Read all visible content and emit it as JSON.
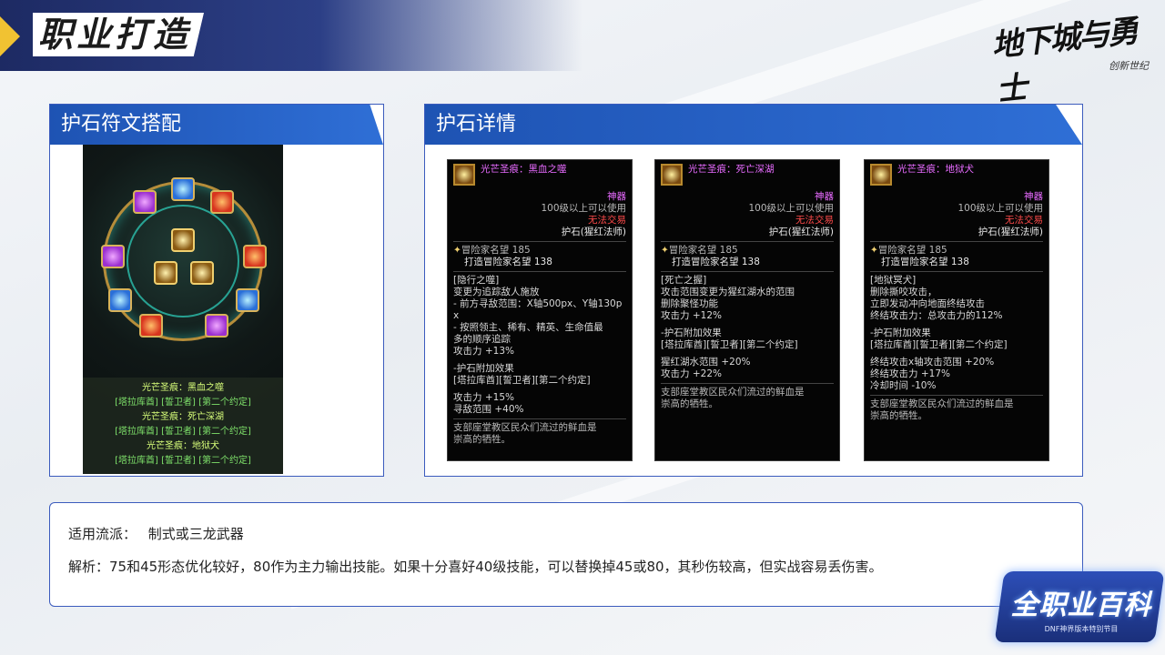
{
  "header": {
    "title": "职业打造"
  },
  "logo": {
    "text": "地下城与勇士",
    "sub": "创新世纪"
  },
  "left_panel": {
    "title": "护石符文搭配",
    "wheel_lines": [
      {
        "name": "光芒圣痕：黑血之噬",
        "sub": "[塔拉库酋] [誓卫者] [第二个约定]"
      },
      {
        "name": "光芒圣痕：死亡深湖",
        "sub": "[塔拉库酋] [誓卫者] [第二个约定]"
      },
      {
        "name": "光芒圣痕：地狱犬",
        "sub": "[塔拉库酋] [誓卫者] [第二个约定]"
      }
    ]
  },
  "right_panel": {
    "title": "护石详情",
    "cards": [
      {
        "title": "光芒圣痕：黑血之噬",
        "rarity": "神器",
        "level_req": "100级以上可以使用",
        "trade": "无法交易",
        "class": "护石(猩红法师)",
        "fame": "冒险家名望 185",
        "forge_fame": "打造冒险家名望 138",
        "skill_name": "[隐行之噬]",
        "lines": [
          "变更为追踪敌人施放",
          "- 前方寻敌范围：X轴500px、Y轴130p",
          "x",
          "- 按照领主、稀有、精英、生命值最",
          "多的顺序追踪",
          "攻击力 +13%"
        ],
        "extra_title": "-护石附加效果",
        "extra_runes": "[塔拉库酋][誓卫者][第二个约定]",
        "extra_lines": [
          "攻击力 +15%",
          "寻敌范围 +40%"
        ],
        "flavor": [
          "支部座堂教区民众们流过的鲜血是",
          "崇高的牺牲。"
        ]
      },
      {
        "title": "光芒圣痕：死亡深湖",
        "rarity": "神器",
        "level_req": "100级以上可以使用",
        "trade": "无法交易",
        "class": "护石(猩红法师)",
        "fame": "冒险家名望 185",
        "forge_fame": "打造冒险家名望 138",
        "skill_name": "[死亡之握]",
        "lines": [
          "攻击范围变更为猩红湖水的范围",
          "删除聚怪功能",
          "攻击力 +12%"
        ],
        "extra_title": "-护石附加效果",
        "extra_runes": "[塔拉库酋][誓卫者][第二个约定]",
        "extra_lines": [
          "猩红湖水范围 +20%",
          "攻击力 +22%"
        ],
        "flavor": [
          "支部座堂教区民众们流过的鲜血是",
          "崇高的牺牲。"
        ]
      },
      {
        "title": "光芒圣痕：地狱犬",
        "rarity": "神器",
        "level_req": "100级以上可以使用",
        "trade": "无法交易",
        "class": "护石(猩红法师)",
        "fame": "冒险家名望 185",
        "forge_fame": "打造冒险家名望 138",
        "skill_name": "[地狱冥犬]",
        "lines": [
          "删除撕咬攻击，",
          "立即发动冲向地面终结攻击",
          "终结攻击力：总攻击力的112%"
        ],
        "extra_title": "-护石附加效果",
        "extra_runes": "[塔拉库酋][誓卫者][第二个约定]",
        "extra_lines": [
          "终结攻击x轴攻击范围 +20%",
          "终结攻击力 +17%",
          "冷却时间 -10%"
        ],
        "flavor": [
          "支部座堂教区民众们流过的鲜血是",
          "崇高的牺牲。"
        ]
      }
    ]
  },
  "info": {
    "line1_label": "适用流派：",
    "line1_value": "制式或三龙武器",
    "line2": "解析：75和45形态优化较好，80作为主力输出技能。如果十分喜好40级技能，可以替换掉45或80，其秒伤较高，但实战容易丢伤害。"
  },
  "badge": {
    "title": "全职业百科",
    "sub": "DNF神界版本特别节目"
  }
}
